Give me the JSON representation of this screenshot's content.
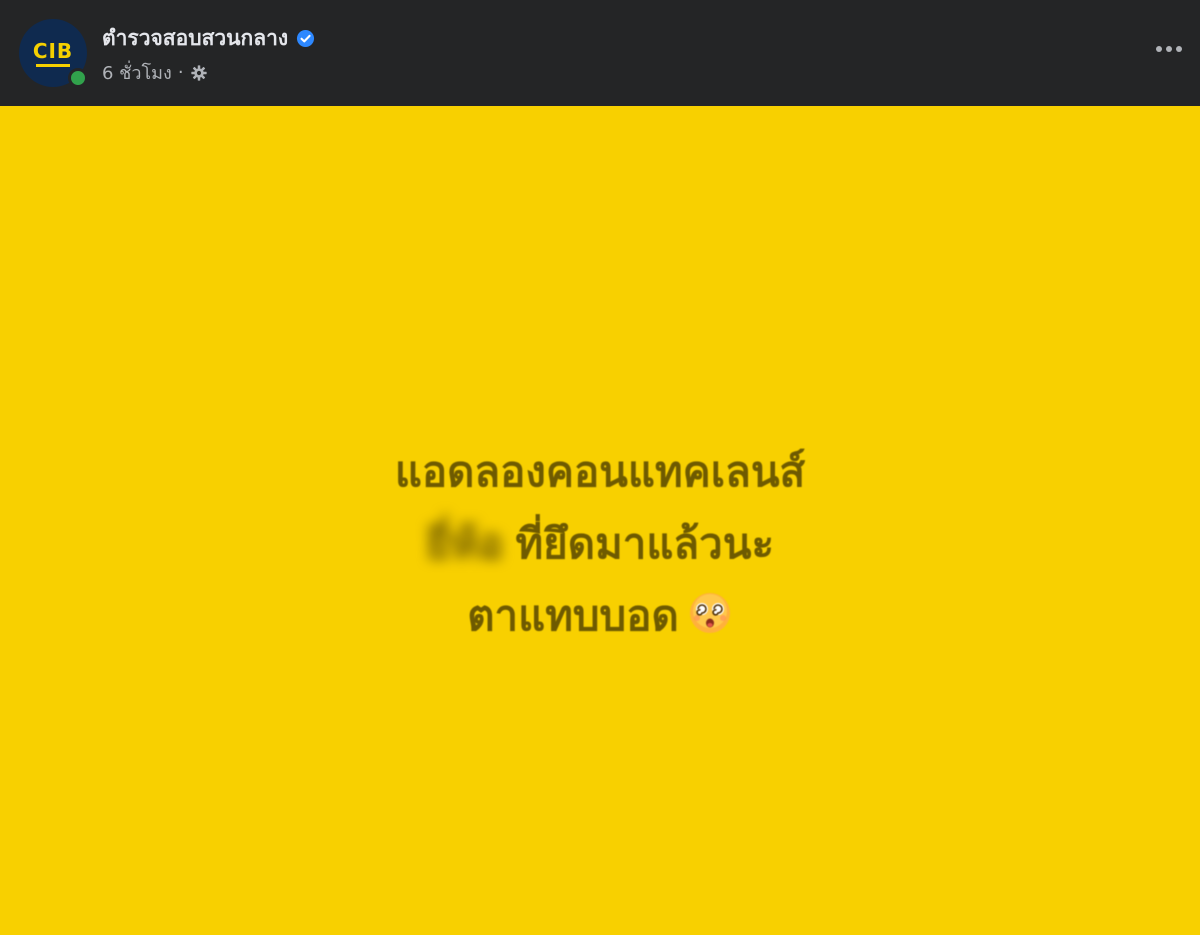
{
  "post": {
    "page_name": "ตำรวจสอบสวนกลาง",
    "avatar_text": "CIB",
    "time": "6 ชั่วโมง",
    "separator": "·",
    "status": {
      "line1": "แอดลองคอนแทคเลนส์",
      "line2_redacted": "ยี่ห้อ",
      "line2": "ที่ยึดมาแล้วนะ",
      "line3": "ตาแทบบอด"
    },
    "colors": {
      "background": "#f8d000",
      "text": "#6e5a00",
      "header_bg": "#242526",
      "verified": "#2d88ff"
    },
    "icons": {
      "verified": "verified-badge-icon",
      "privacy": "gear-icon",
      "more": "more-horizontal-icon",
      "emoji": "dizzy-face-emoji"
    }
  }
}
